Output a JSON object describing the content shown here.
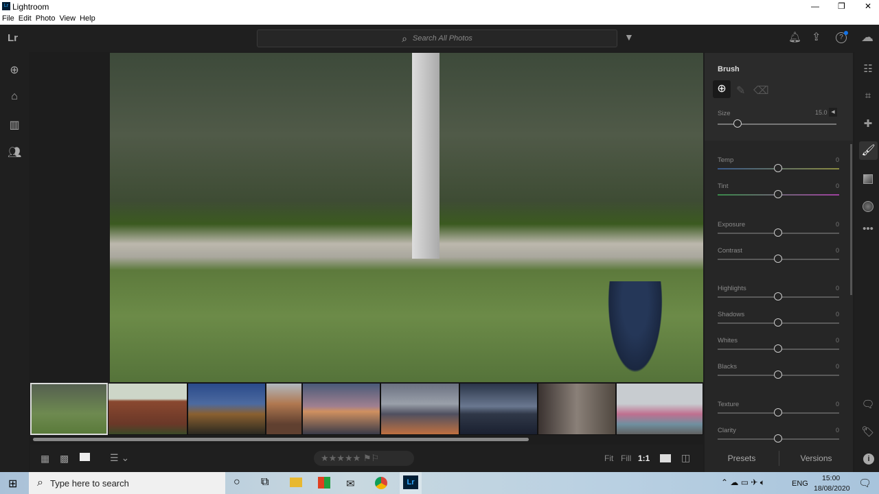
{
  "window": {
    "title": "Lightroom",
    "controls": [
      "—",
      "❐",
      "✕"
    ]
  },
  "menu": [
    "File",
    "Edit",
    "Photo",
    "View",
    "Help"
  ],
  "topbar": {
    "logo": "Lr",
    "search_placeholder": "Search All Photos"
  },
  "brush": {
    "title": "Brush",
    "size_label": "Size",
    "size_value": "15.0",
    "size_fraction": 0.17
  },
  "sliders": [
    {
      "label": "Temp",
      "value": "0"
    },
    {
      "label": "Tint",
      "value": "0"
    },
    {
      "label": "Exposure",
      "value": "0"
    },
    {
      "label": "Contrast",
      "value": "0"
    },
    {
      "label": "Highlights",
      "value": "0"
    },
    {
      "label": "Shadows",
      "value": "0"
    },
    {
      "label": "Whites",
      "value": "0"
    },
    {
      "label": "Blacks",
      "value": "0"
    },
    {
      "label": "Texture",
      "value": "0"
    },
    {
      "label": "Clarity",
      "value": "0"
    }
  ],
  "bottom": {
    "fit": "Fit",
    "fill": "Fill",
    "one": "1:1",
    "presets": "Presets",
    "versions": "Versions"
  },
  "taskbar": {
    "search": "Type here to search",
    "lang": "ENG",
    "time": "15:00",
    "date": "18/08/2020"
  },
  "colors": {
    "accent": "#1473e6",
    "panel": "#262626"
  }
}
